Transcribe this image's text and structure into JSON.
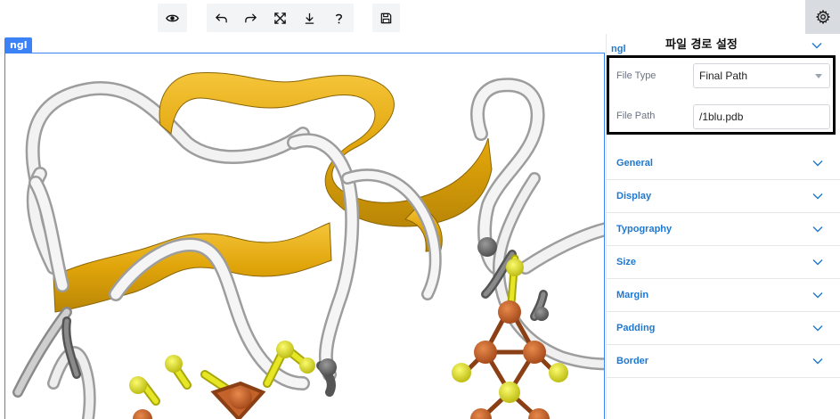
{
  "toolbar": {
    "icons": [
      "eye-icon",
      "undo-icon",
      "redo-icon",
      "fullscreen-icon",
      "download-icon",
      "help-icon",
      "save-icon",
      "gear-icon"
    ]
  },
  "canvas": {
    "tag": "ngl"
  },
  "panel": {
    "subtitle": "ngl",
    "title": "파일 경로 설정",
    "file_type_label": "File Type",
    "file_type_value": "Final Path",
    "file_path_label": "File Path",
    "file_path_value": "/1blu.pdb",
    "sections": [
      "General",
      "Display",
      "Typography",
      "Size",
      "Margin",
      "Padding",
      "Border"
    ]
  },
  "colors": {
    "accent": "#1e78d0",
    "canvas_border": "#3b82f6",
    "ribbon_gold": "#e6ad0f",
    "ribbon_white": "#e8e8e8",
    "atom_yellow": "#e3e31f",
    "atom_orange": "#c8602a",
    "atom_gray": "#707070"
  }
}
